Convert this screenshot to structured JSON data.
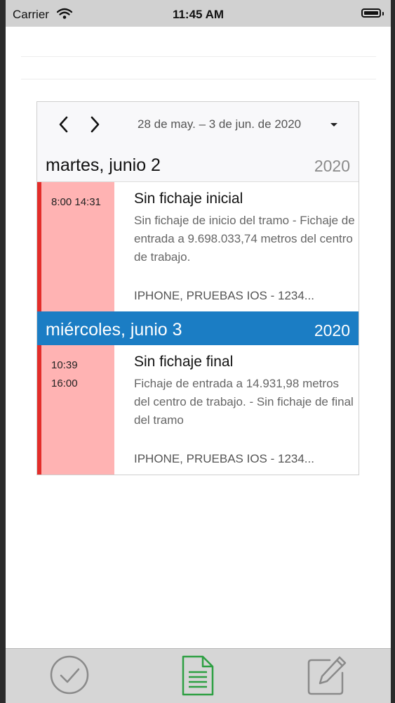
{
  "status_bar": {
    "carrier": "Carrier",
    "time": "11:45 AM",
    "icons": [
      "wifi-icon",
      "battery-icon"
    ]
  },
  "calendar": {
    "date_range": "28 de may. – 3 de jun. de 2020",
    "prev_icon": "chevron-left-icon",
    "next_icon": "chevron-right-icon",
    "dropdown_icon": "caret-down-icon",
    "days": [
      {
        "title": "martes, junio 2",
        "year": "2020",
        "selected": false,
        "event": {
          "time": "8:00 14:31",
          "title": "Sin fichaje inicial",
          "description": "Sin fichaje de inicio del tramo - Fichaje de entrada a 9.698.033,74 metros del centro de trabajo.",
          "device": "IPHONE, PRUEBAS IOS - 1234..."
        }
      },
      {
        "title": "miércoles, junio 3",
        "year": "2020",
        "selected": true,
        "event": {
          "time_start": "10:39",
          "time_end": "16:00",
          "title": "Sin fichaje final",
          "description": "Fichaje de entrada a 14.931,98 metros del centro de trabajo. - Sin fichaje de final del tramo",
          "device": "IPHONE, PRUEBAS IOS - 1234..."
        }
      }
    ]
  },
  "tab_bar": {
    "tabs": [
      {
        "icon": "checkmark-circle-icon",
        "active": false
      },
      {
        "icon": "document-icon",
        "active": true
      },
      {
        "icon": "edit-icon",
        "active": false
      }
    ]
  },
  "colors": {
    "selected_day": "#1b7dc4",
    "event_marker": "#e32d2a",
    "event_background": "#ffb3b3",
    "active_tab": "#2ea043",
    "inactive_tab": "#8a8a8a"
  }
}
